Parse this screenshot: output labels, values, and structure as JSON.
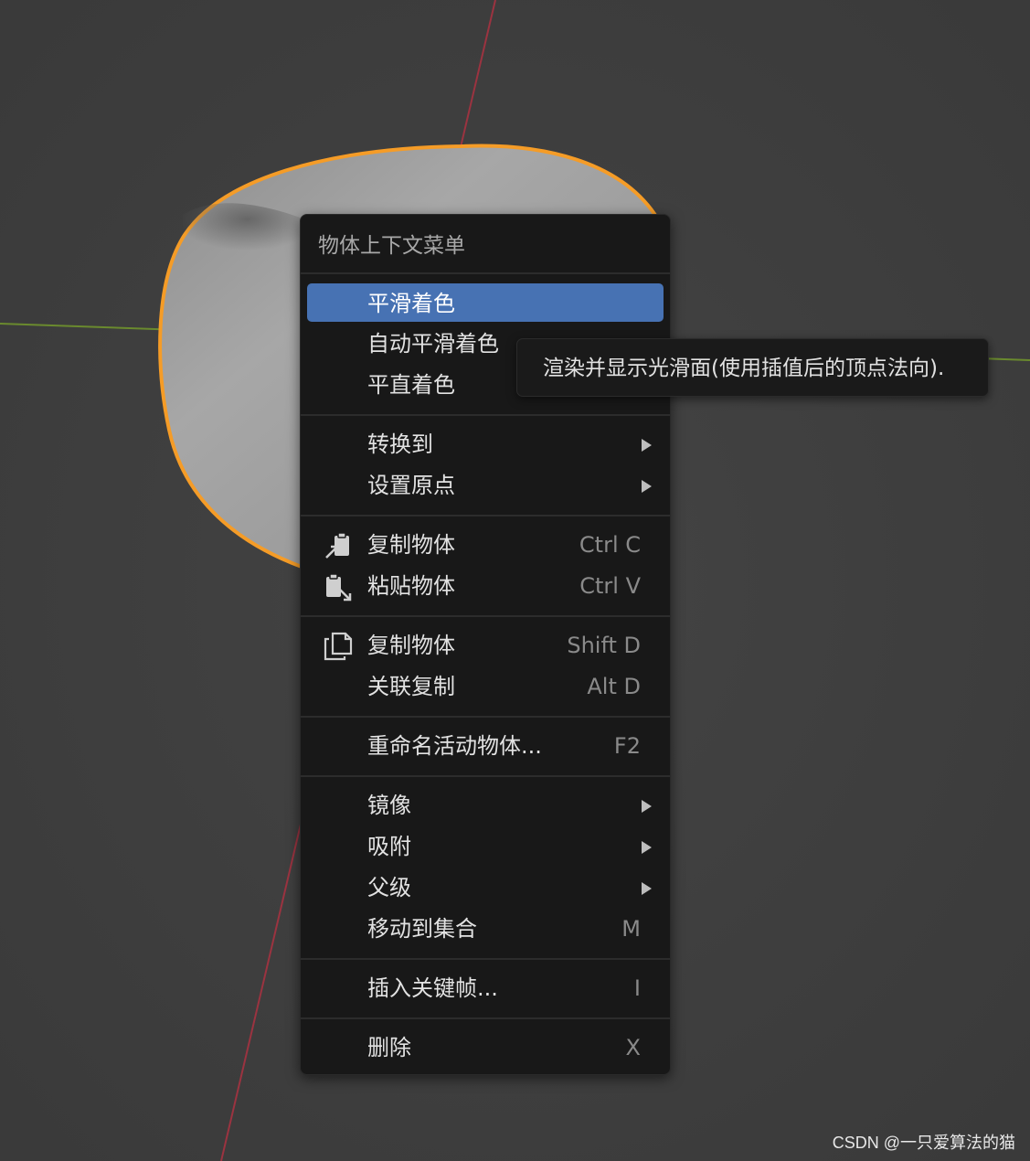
{
  "menu": {
    "title": "物体上下文菜单",
    "groups": [
      {
        "items": [
          {
            "label": "平滑着色",
            "active": true
          },
          {
            "label": "自动平滑着色"
          },
          {
            "label": "平直着色"
          }
        ]
      },
      {
        "items": [
          {
            "label": "转换到",
            "submenu": true
          },
          {
            "label": "设置原点",
            "submenu": true
          }
        ]
      },
      {
        "items": [
          {
            "label": "复制物体",
            "shortcut": "Ctrl C",
            "icon": "copy-clipboard-icon"
          },
          {
            "label": "粘贴物体",
            "shortcut": "Ctrl V",
            "icon": "paste-clipboard-icon"
          }
        ]
      },
      {
        "items": [
          {
            "label": "复制物体",
            "shortcut": "Shift D",
            "icon": "duplicate-icon"
          },
          {
            "label": "关联复制",
            "shortcut": "Alt D"
          }
        ]
      },
      {
        "items": [
          {
            "label": "重命名活动物体...",
            "shortcut": "F2"
          }
        ]
      },
      {
        "items": [
          {
            "label": "镜像",
            "submenu": true
          },
          {
            "label": "吸附",
            "submenu": true
          },
          {
            "label": "父级",
            "submenu": true
          },
          {
            "label": "移动到集合",
            "shortcut": "M"
          }
        ]
      },
      {
        "items": [
          {
            "label": "插入关键帧...",
            "shortcut": "I"
          }
        ]
      },
      {
        "items": [
          {
            "label": "删除",
            "shortcut": "X"
          }
        ]
      }
    ]
  },
  "tooltip": {
    "text": "渲染并显示光滑面(使用插值后的顶点法向)."
  },
  "watermark": "CSDN @一只爱算法的猫",
  "colors": {
    "background": "#3d3d3d",
    "menu_bg": "#181818",
    "highlight": "#4772b3",
    "selection_outline": "#f59c27",
    "x_axis": "#9b3340",
    "y_axis": "#6a8a2e"
  }
}
